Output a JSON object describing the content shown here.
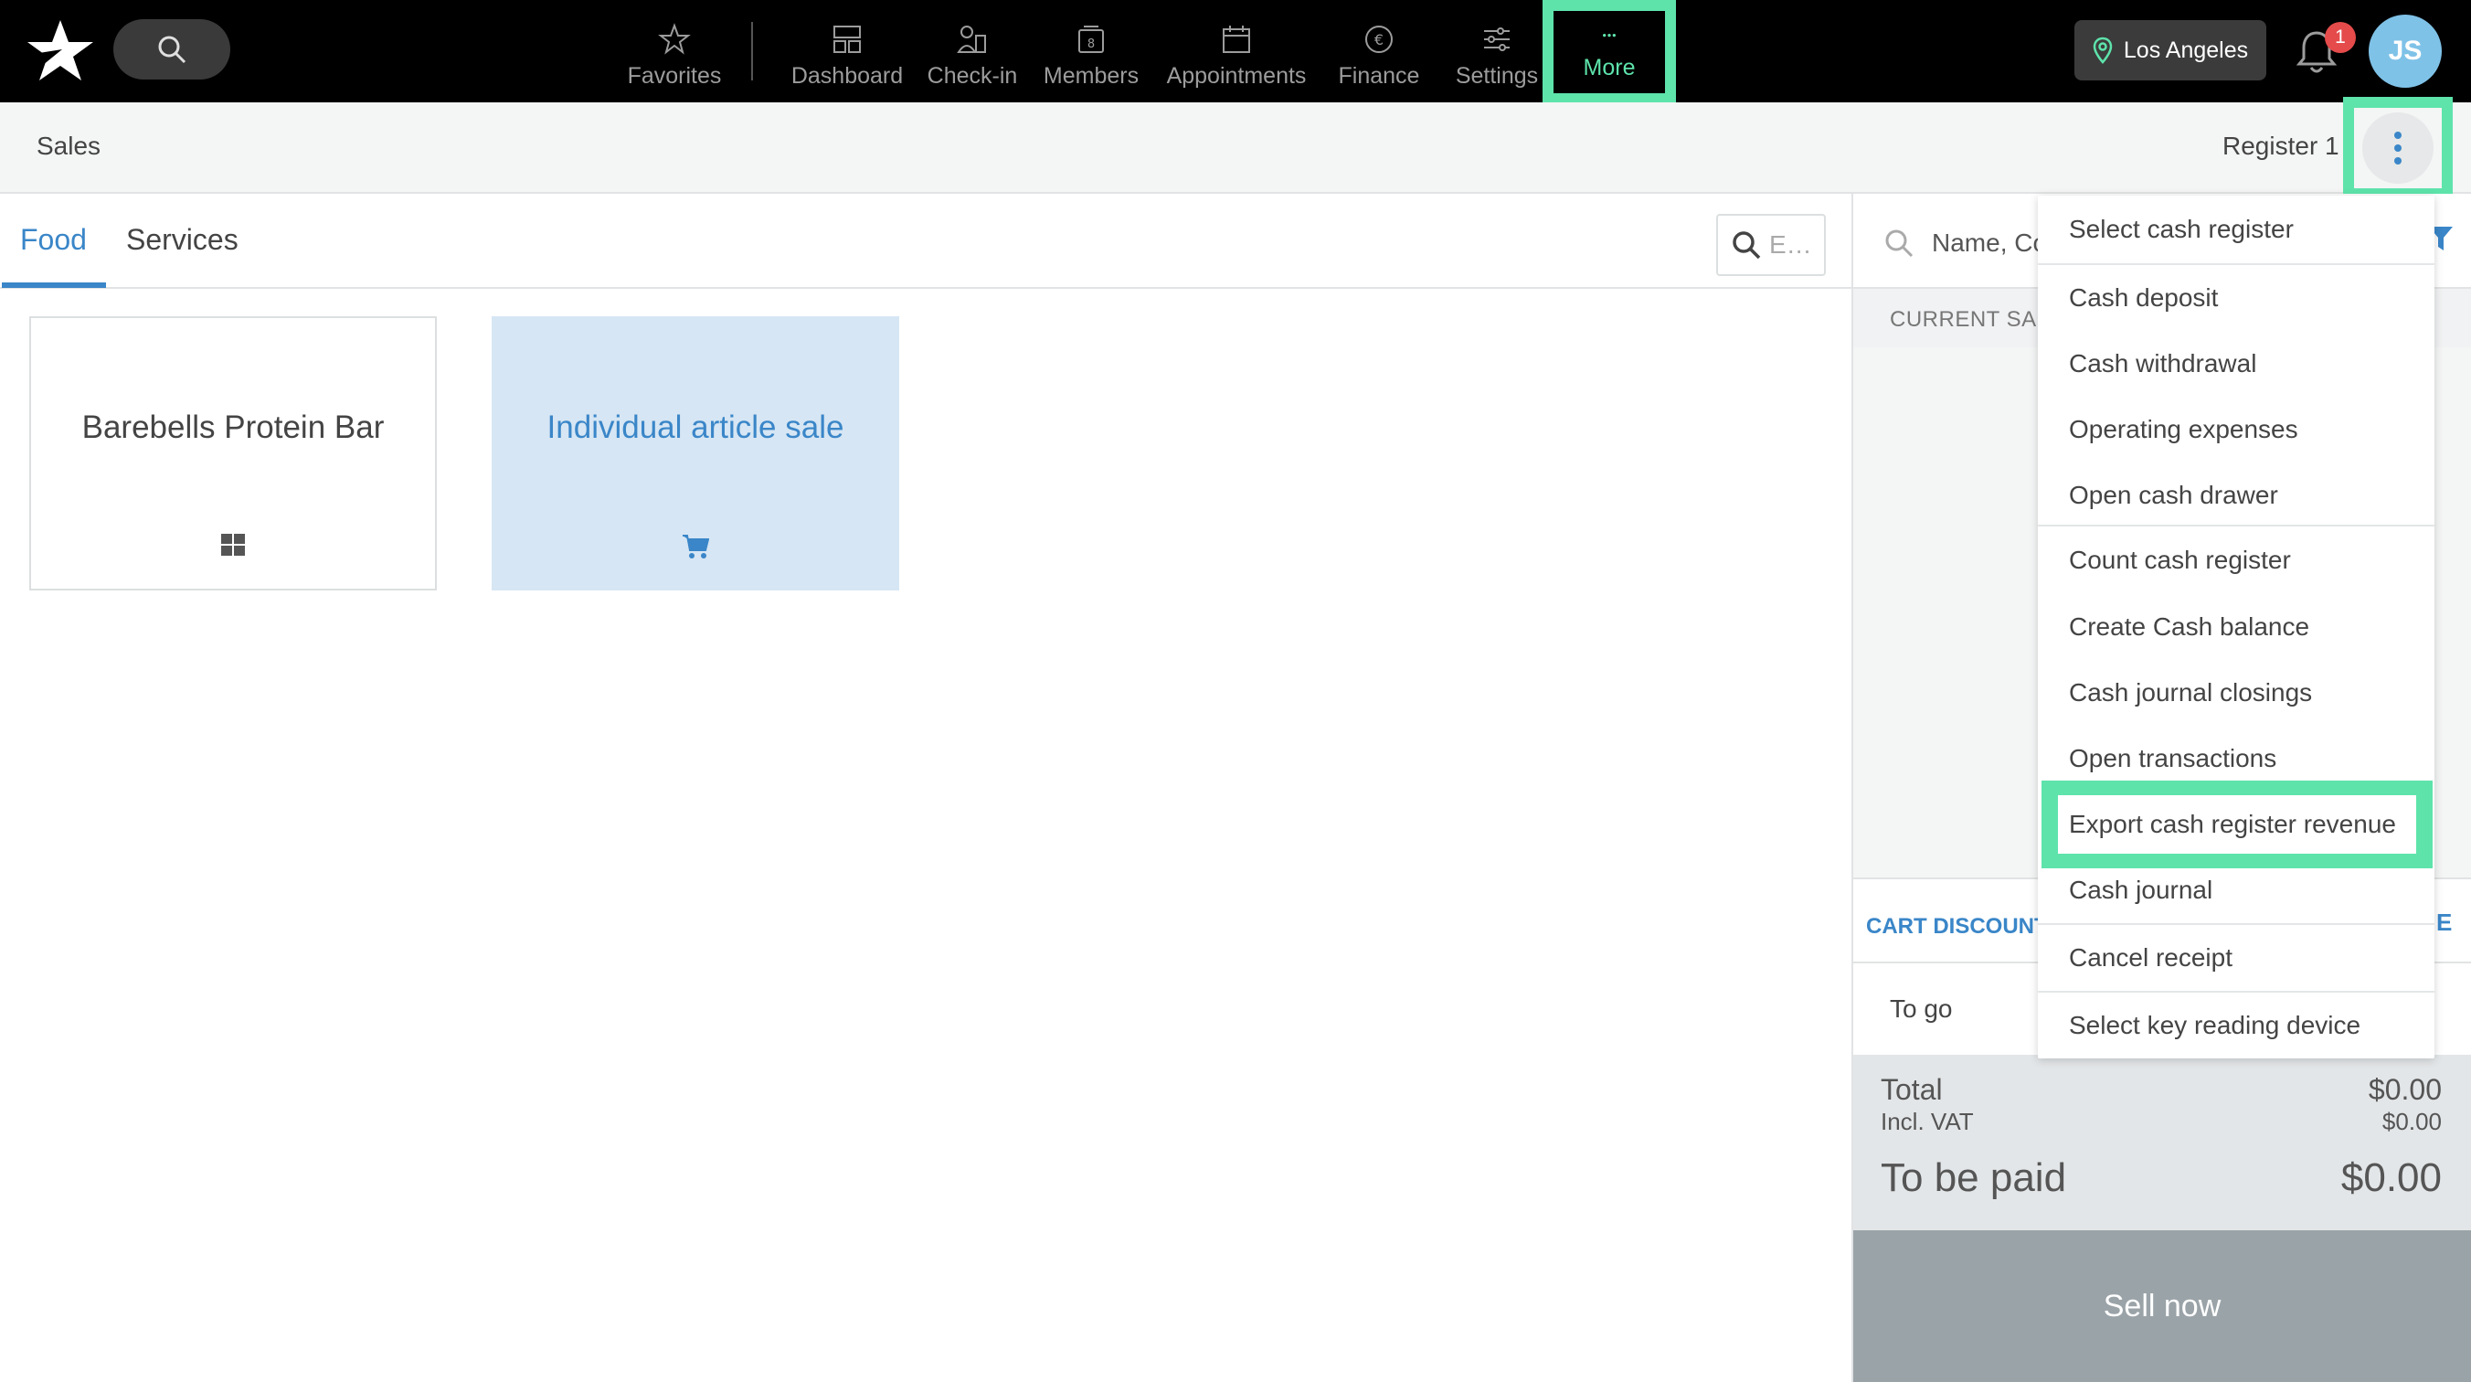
{
  "topbar": {
    "nav": [
      {
        "label": "Favorites",
        "icon": "star-icon"
      },
      {
        "label": "Dashboard",
        "icon": "dashboard-icon"
      },
      {
        "label": "Check-in",
        "icon": "check-in-icon"
      },
      {
        "label": "Members",
        "icon": "members-icon"
      },
      {
        "label": "Appointments",
        "icon": "calendar-icon"
      },
      {
        "label": "Finance",
        "icon": "euro-icon"
      },
      {
        "label": "Settings",
        "icon": "sliders-icon"
      },
      {
        "label": "More",
        "icon": "more-dots-icon"
      }
    ],
    "location": "Los Angeles",
    "notification_count": "1",
    "avatar_initials": "JS"
  },
  "subheader": {
    "title": "Sales",
    "register": "Register 1"
  },
  "products": {
    "tabs": [
      "Food",
      "Services"
    ],
    "active_tab": "Food",
    "search_placeholder": "E…",
    "tiles": [
      {
        "label": "Barebells Protein Bar",
        "icon": "grid-icon"
      },
      {
        "label": "Individual article sale",
        "icon": "cart-icon"
      }
    ]
  },
  "cart": {
    "search_placeholder": "Name, Co",
    "current_sale_label": "CURRENT SAL",
    "cart_discount_label": "CART DISCOUNT",
    "discount_action_fragment": "E",
    "to_go_label": "To go",
    "total_label": "Total",
    "total_value": "$0.00",
    "vat_label": "Incl. VAT",
    "vat_value": "$0.00",
    "to_be_paid_label": "To be paid",
    "to_be_paid_value": "$0.00",
    "sell_button": "Sell now"
  },
  "menu": {
    "items": [
      "Select cash register",
      "Cash deposit",
      "Cash withdrawal",
      "Operating expenses",
      "Open cash drawer",
      "Count cash register",
      "Create Cash balance",
      "Cash journal closings",
      "Open transactions",
      "Export cash register revenue",
      "Cash journal",
      "Cancel receipt",
      "Select key reading device"
    ],
    "highlighted": "Export cash register revenue"
  },
  "colors": {
    "highlight": "#5ee3ab",
    "accent": "#3a86c8",
    "topbar": "#000000"
  }
}
